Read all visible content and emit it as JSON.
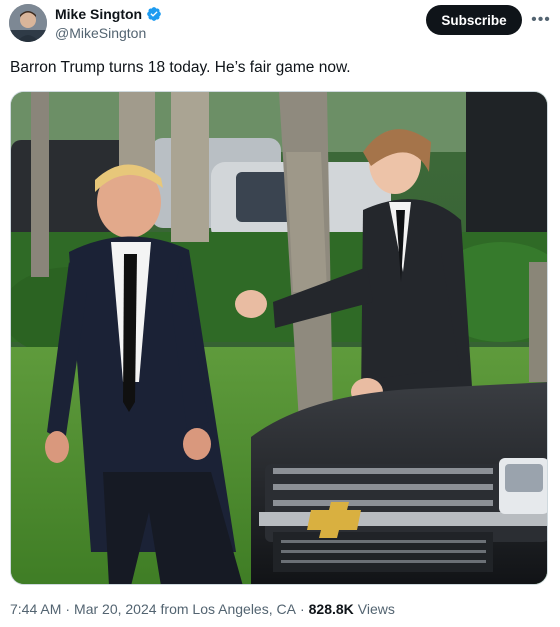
{
  "author": {
    "display_name": "Mike Sington",
    "handle": "@MikeSington",
    "verified": true,
    "verified_icon": "verified-badge-icon",
    "verified_color": "#1d9bf0"
  },
  "actions": {
    "subscribe_label": "Subscribe",
    "more_icon": "more-horizontal-icon"
  },
  "tweet": {
    "text": "Barron Trump turns 18 today. He’s fair game now."
  },
  "meta": {
    "time": "7:44 AM",
    "date": "Mar 20, 2024",
    "location": "from Los Angeles, CA",
    "views_count": "828.8K",
    "views_label": "Views",
    "separator": "·"
  },
  "colors": {
    "text_primary": "#0f1419",
    "text_secondary": "#536471",
    "button_bg": "#0f1419"
  }
}
